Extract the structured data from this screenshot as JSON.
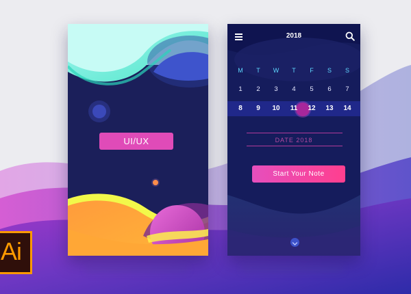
{
  "left_screen": {
    "button_label": "UI/UX"
  },
  "right_screen": {
    "header": {
      "year": "2018",
      "menu_icon": "hamburger-menu-icon",
      "search_icon": "search-icon"
    },
    "weekdays": [
      "M",
      "T",
      "W",
      "T",
      "F",
      "S",
      "S"
    ],
    "calendar_rows": [
      [
        "1",
        "2",
        "3",
        "4",
        "5",
        "6",
        "7"
      ],
      [
        "8",
        "9",
        "10",
        "11",
        "12",
        "13",
        "14"
      ]
    ],
    "selected_day": "11",
    "date_field_label": "DATE 2018",
    "note_button_label": "Start Your Note",
    "scroll_icon": "chevron-down-icon"
  },
  "logo": {
    "text": "Ai",
    "colors": {
      "text": "#ff9a00",
      "background": "#2f0f0a"
    }
  },
  "colors": {
    "accent_pink": "#e04bb8",
    "screen_navy": "#1b1f5a",
    "weekday_cyan": "#5fd8ff",
    "selected_day": "#a7279b"
  }
}
